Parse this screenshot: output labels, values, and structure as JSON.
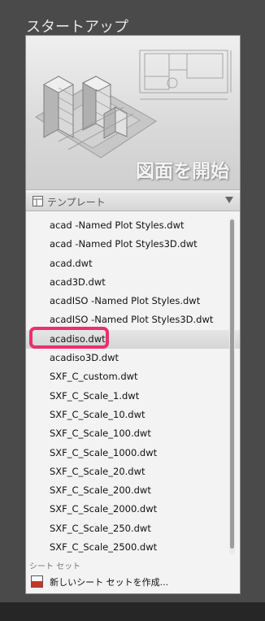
{
  "header": {
    "title": "スタートアップ"
  },
  "hero": {
    "title": "図面を開始"
  },
  "template_section": {
    "label": "テンプレート"
  },
  "templates": [
    "acad -Named Plot Styles.dwt",
    "acad -Named Plot Styles3D.dwt",
    "acad.dwt",
    "acad3D.dwt",
    "acadISO -Named Plot Styles.dwt",
    "acadISO -Named Plot Styles3D.dwt",
    "acadiso.dwt",
    "acadiso3D.dwt",
    "SXF_C_custom.dwt",
    "SXF_C_Scale_1.dwt",
    "SXF_C_Scale_10.dwt",
    "SXF_C_Scale_100.dwt",
    "SXF_C_Scale_1000.dwt",
    "SXF_C_Scale_20.dwt",
    "SXF_C_Scale_200.dwt",
    "SXF_C_Scale_2000.dwt",
    "SXF_C_Scale_250.dwt",
    "SXF_C_Scale_2500.dwt"
  ],
  "selected_template": "acadiso.dwt",
  "sheet_set": {
    "label": "シート セット",
    "action_label": "新しいシート セットを作成...",
    "icon_text": "DST"
  },
  "colors": {
    "highlight": "#e8316f",
    "background": "#4a4a4a"
  }
}
